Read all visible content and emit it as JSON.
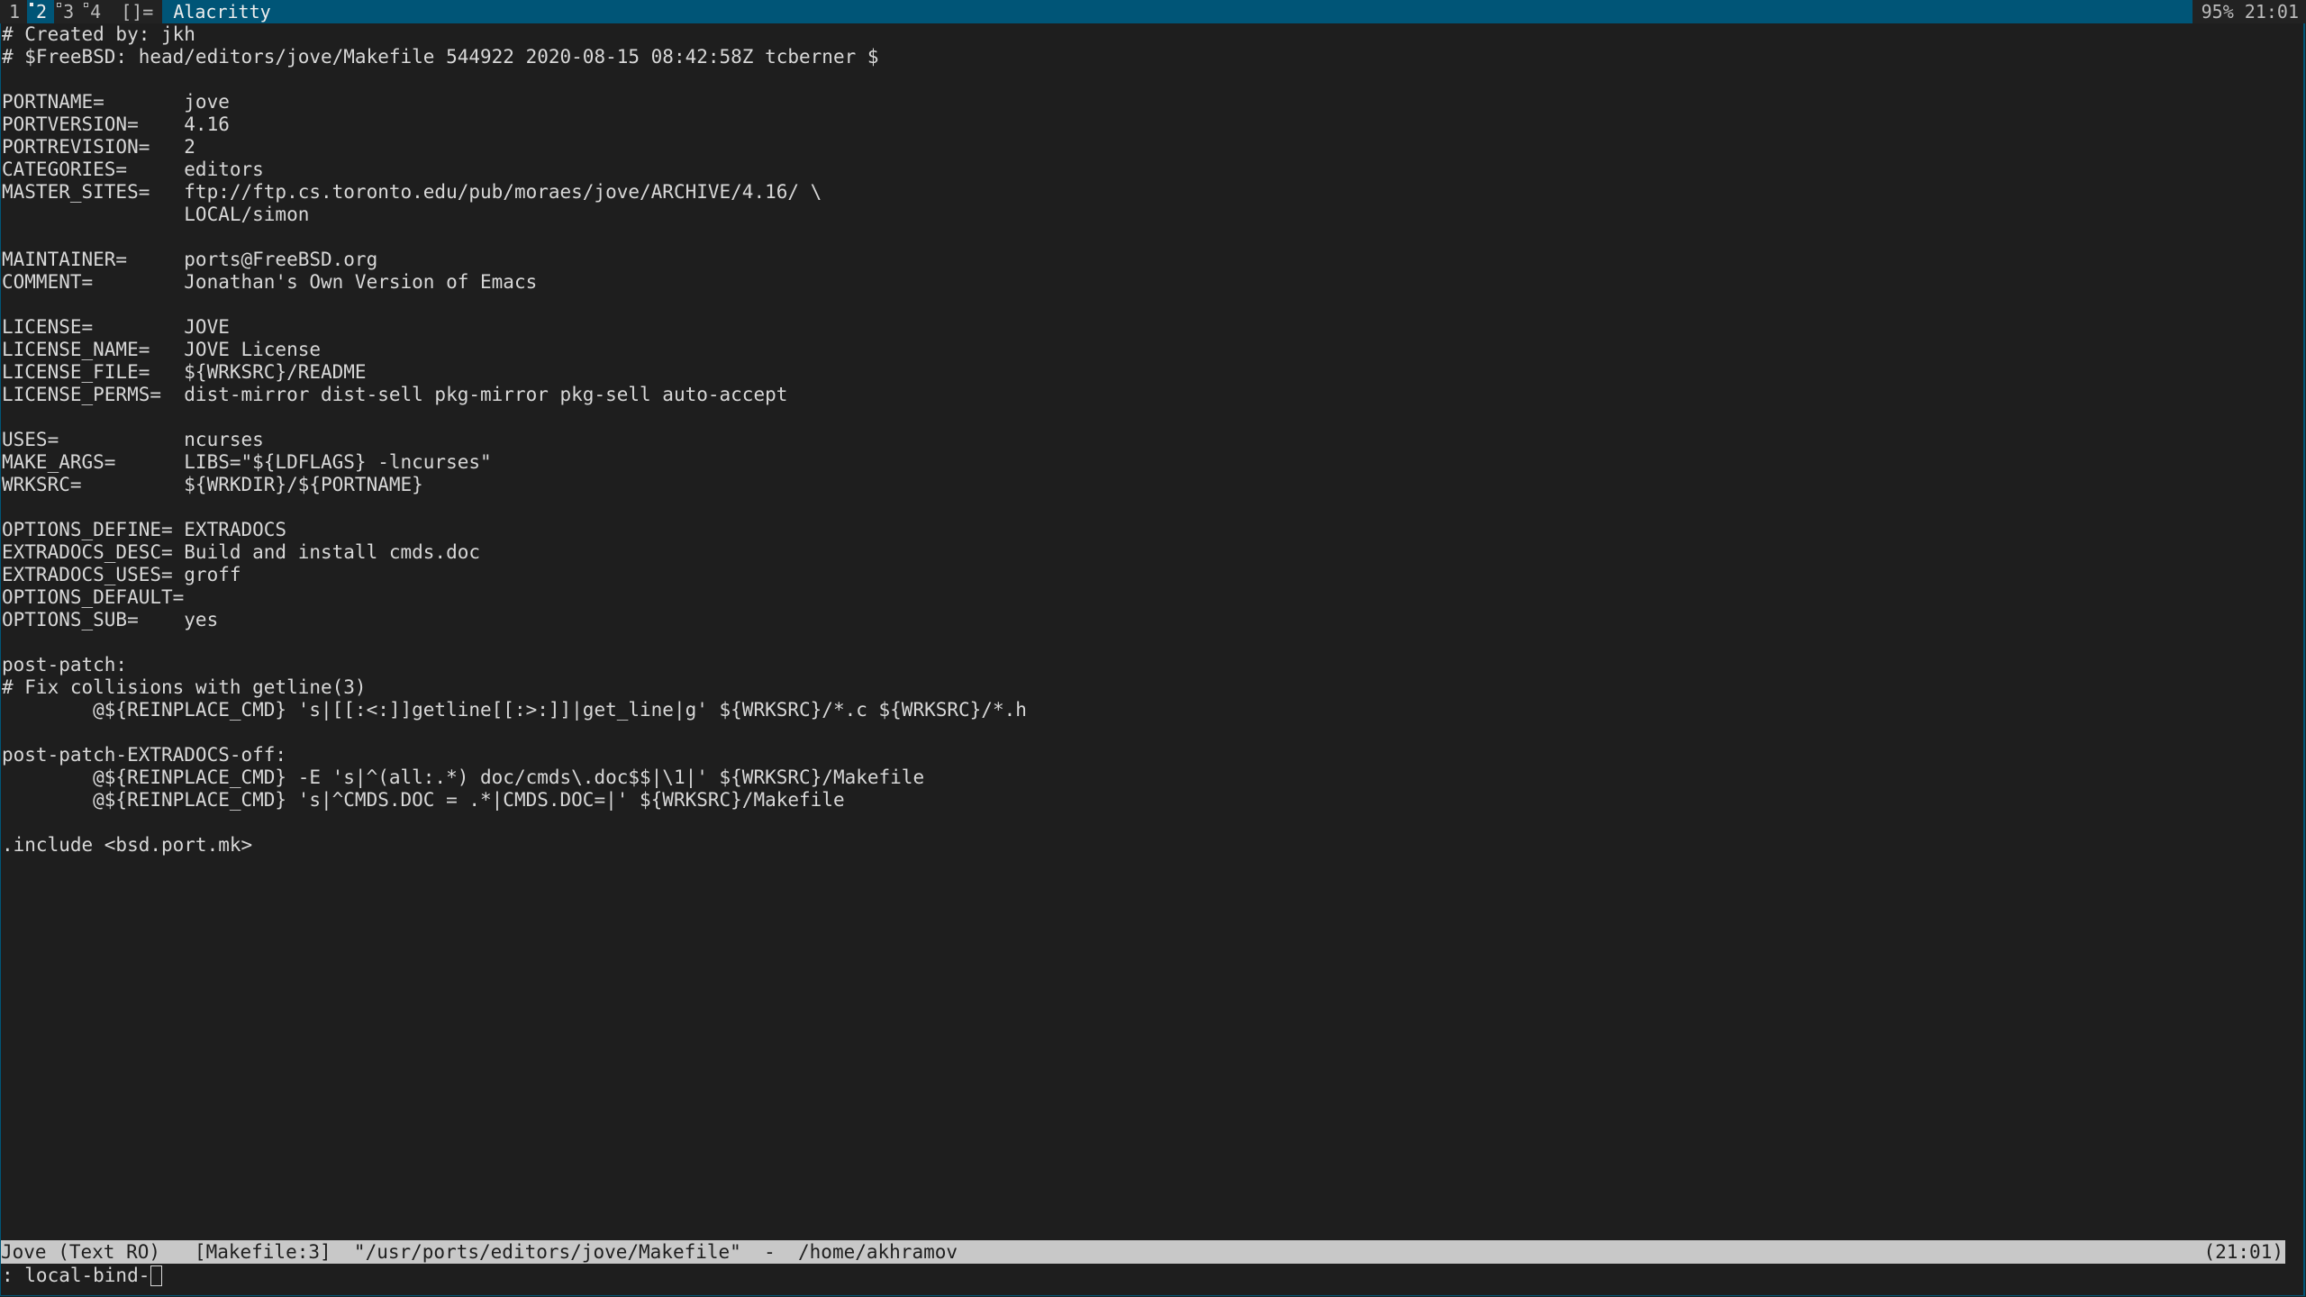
{
  "topbar": {
    "tags": [
      {
        "label": "1",
        "selected": false,
        "occupied": "none"
      },
      {
        "label": "2",
        "selected": true,
        "occupied": "filled"
      },
      {
        "label": "3",
        "selected": false,
        "occupied": "hollow"
      },
      {
        "label": "4",
        "selected": false,
        "occupied": "hollow"
      }
    ],
    "layout_symbol": "[]=",
    "window_title": "Alacritty",
    "status_text": "95% 21:01"
  },
  "buffer": {
    "lines": [
      "# Created by: jkh",
      "# $FreeBSD: head/editors/jove/Makefile 544922 2020-08-15 08:42:58Z tcberner $",
      "",
      "PORTNAME=       jove",
      "PORTVERSION=    4.16",
      "PORTREVISION=   2",
      "CATEGORIES=     editors",
      "MASTER_SITES=   ftp://ftp.cs.toronto.edu/pub/moraes/jove/ARCHIVE/4.16/ \\",
      "                LOCAL/simon",
      "",
      "MAINTAINER=     ports@FreeBSD.org",
      "COMMENT=        Jonathan's Own Version of Emacs",
      "",
      "LICENSE=        JOVE",
      "LICENSE_NAME=   JOVE License",
      "LICENSE_FILE=   ${WRKSRC}/README",
      "LICENSE_PERMS=  dist-mirror dist-sell pkg-mirror pkg-sell auto-accept",
      "",
      "USES=           ncurses",
      "MAKE_ARGS=      LIBS=\"${LDFLAGS} -lncurses\"",
      "WRKSRC=         ${WRKDIR}/${PORTNAME}",
      "",
      "OPTIONS_DEFINE= EXTRADOCS",
      "EXTRADOCS_DESC= Build and install cmds.doc",
      "EXTRADOCS_USES= groff",
      "OPTIONS_DEFAULT=",
      "OPTIONS_SUB=    yes",
      "",
      "post-patch:",
      "# Fix collisions with getline(3)",
      "        @${REINPLACE_CMD} 's|[[:<:]]getline[[:>:]]|get_line|g' ${WRKSRC}/*.c ${WRKSRC}/*.h",
      "",
      "post-patch-EXTRADOCS-off:",
      "        @${REINPLACE_CMD} -E 's|^(all:.*) doc/cmds\\.doc$$|\\1|' ${WRKSRC}/Makefile",
      "        @${REINPLACE_CMD} 's|^CMDS.DOC = .*|CMDS.DOC=|' ${WRKSRC}/Makefile",
      "",
      ".include <bsd.port.mk>"
    ]
  },
  "modeline": {
    "left": "Jove (Text RO)   [Makefile:3]  \"/usr/ports/editors/jove/Makefile\"  -  /home/akhramov",
    "right": "(21:01)"
  },
  "minibuffer": {
    "prompt": ": local-bind-"
  },
  "colors": {
    "bar_accent": "#005577",
    "bar_bg": "#222222",
    "terminal_bg": "#1e1e1e",
    "terminal_fg": "#d8d8d8",
    "modeline_bg": "#c8c8c8"
  }
}
